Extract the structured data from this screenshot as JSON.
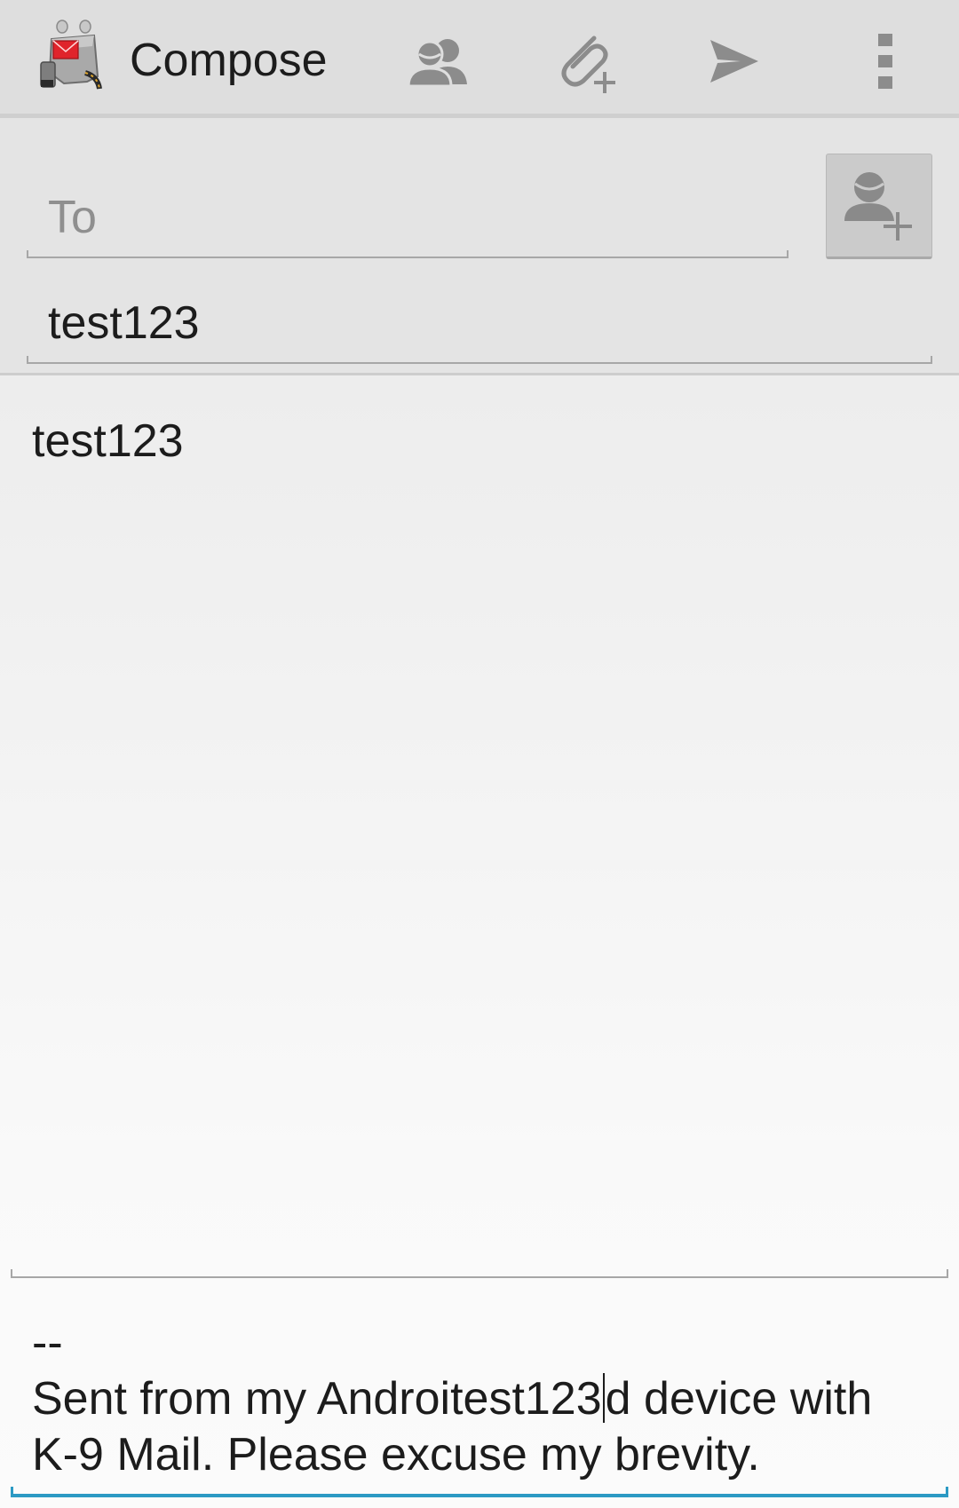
{
  "action_bar": {
    "title": "Compose",
    "actions": [
      {
        "name": "add-from-contacts",
        "icon": "contacts-icon"
      },
      {
        "name": "attach-file",
        "icon": "attachment-add-icon"
      },
      {
        "name": "send",
        "icon": "send-icon"
      },
      {
        "name": "overflow-menu",
        "icon": "more-vert-icon"
      }
    ],
    "app_icon": "k9-mail-logo"
  },
  "fields": {
    "to": {
      "value": "",
      "placeholder": "To"
    },
    "subject": {
      "value": "test123"
    },
    "add_contact_icon": "person-add-icon"
  },
  "body": {
    "text": "test123"
  },
  "signature": {
    "separator": "--",
    "line1_before_cursor": "Sent from my Androitest123",
    "line1_after_cursor": "d device with",
    "line2": "K-9 Mail. Please excuse my brevity."
  },
  "colors": {
    "action_bar_bg": "#dedede",
    "header_bg": "#e4e4e4",
    "focus_underline": "#2c9ac4",
    "icon_gray": "#8c8c8c"
  }
}
